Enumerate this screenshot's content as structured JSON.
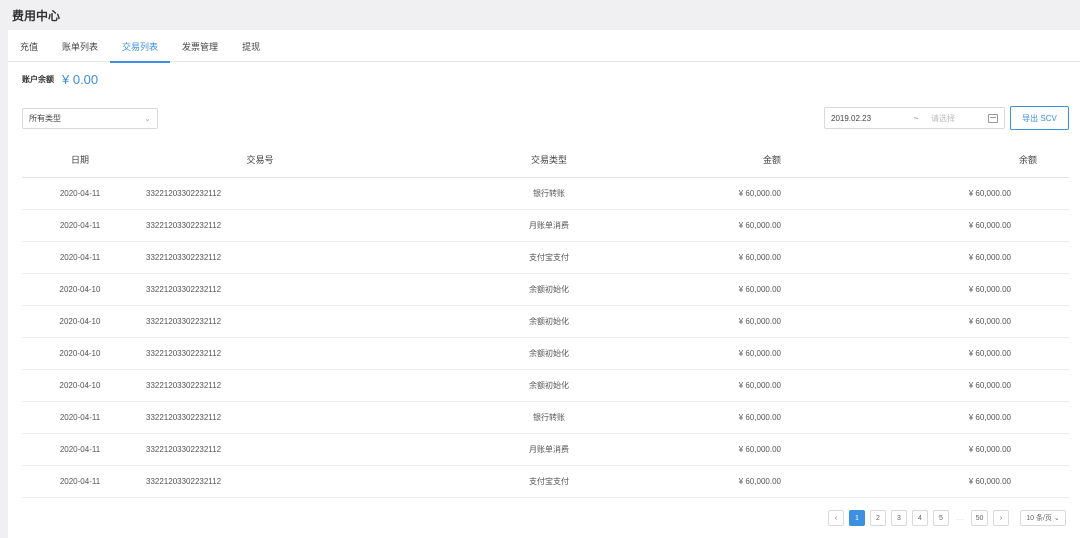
{
  "header": {
    "title": "费用中心"
  },
  "tabs": [
    {
      "label": "充值",
      "active": false
    },
    {
      "label": "账单列表",
      "active": false
    },
    {
      "label": "交易列表",
      "active": true
    },
    {
      "label": "发票管理",
      "active": false
    },
    {
      "label": "提现",
      "active": false
    }
  ],
  "balance": {
    "label": "账户余额",
    "value": "¥ 0.00"
  },
  "filters": {
    "type_select": "所有类型",
    "date_start": "2019.02.23",
    "date_sep": "~",
    "date_end_placeholder": "请选择",
    "export_label": "导出 SCV"
  },
  "table": {
    "columns": [
      "日期",
      "交易号",
      "交易类型",
      "金额",
      "余额"
    ],
    "rows": [
      [
        "2020-04-11",
        "33221203302232112",
        "银行转账",
        "¥ 60,000.00",
        "¥ 60,000.00"
      ],
      [
        "2020-04-11",
        "33221203302232112",
        "月账单消费",
        "¥ 60,000.00",
        "¥ 60,000.00"
      ],
      [
        "2020-04-11",
        "33221203302232112",
        "支付宝支付",
        "¥ 60,000.00",
        "¥ 60,000.00"
      ],
      [
        "2020-04-10",
        "33221203302232112",
        "余额初始化",
        "¥ 60,000.00",
        "¥ 60,000.00"
      ],
      [
        "2020-04-10",
        "33221203302232112",
        "余额初始化",
        "¥ 60,000.00",
        "¥ 60,000.00"
      ],
      [
        "2020-04-10",
        "33221203302232112",
        "余额初始化",
        "¥ 60,000.00",
        "¥ 60,000.00"
      ],
      [
        "2020-04-10",
        "33221203302232112",
        "余额初始化",
        "¥ 60,000.00",
        "¥ 60,000.00"
      ],
      [
        "2020-04-11",
        "33221203302232112",
        "银行转账",
        "¥ 60,000.00",
        "¥ 60,000.00"
      ],
      [
        "2020-04-11",
        "33221203302232112",
        "月账单消费",
        "¥ 60,000.00",
        "¥ 60,000.00"
      ],
      [
        "2020-04-11",
        "33221203302232112",
        "支付宝支付",
        "¥ 60,000.00",
        "¥ 60,000.00"
      ]
    ]
  },
  "pagination": {
    "prev": "‹",
    "pages": [
      "1",
      "2",
      "3",
      "4",
      "5"
    ],
    "current": "1",
    "ellipsis": "…",
    "last": "50",
    "next": "›",
    "page_size": "10 条/页 ⌄"
  },
  "colors": {
    "accent": "#3d8fe0",
    "border": "#d9d9d9",
    "background": "#f0f0f2"
  }
}
